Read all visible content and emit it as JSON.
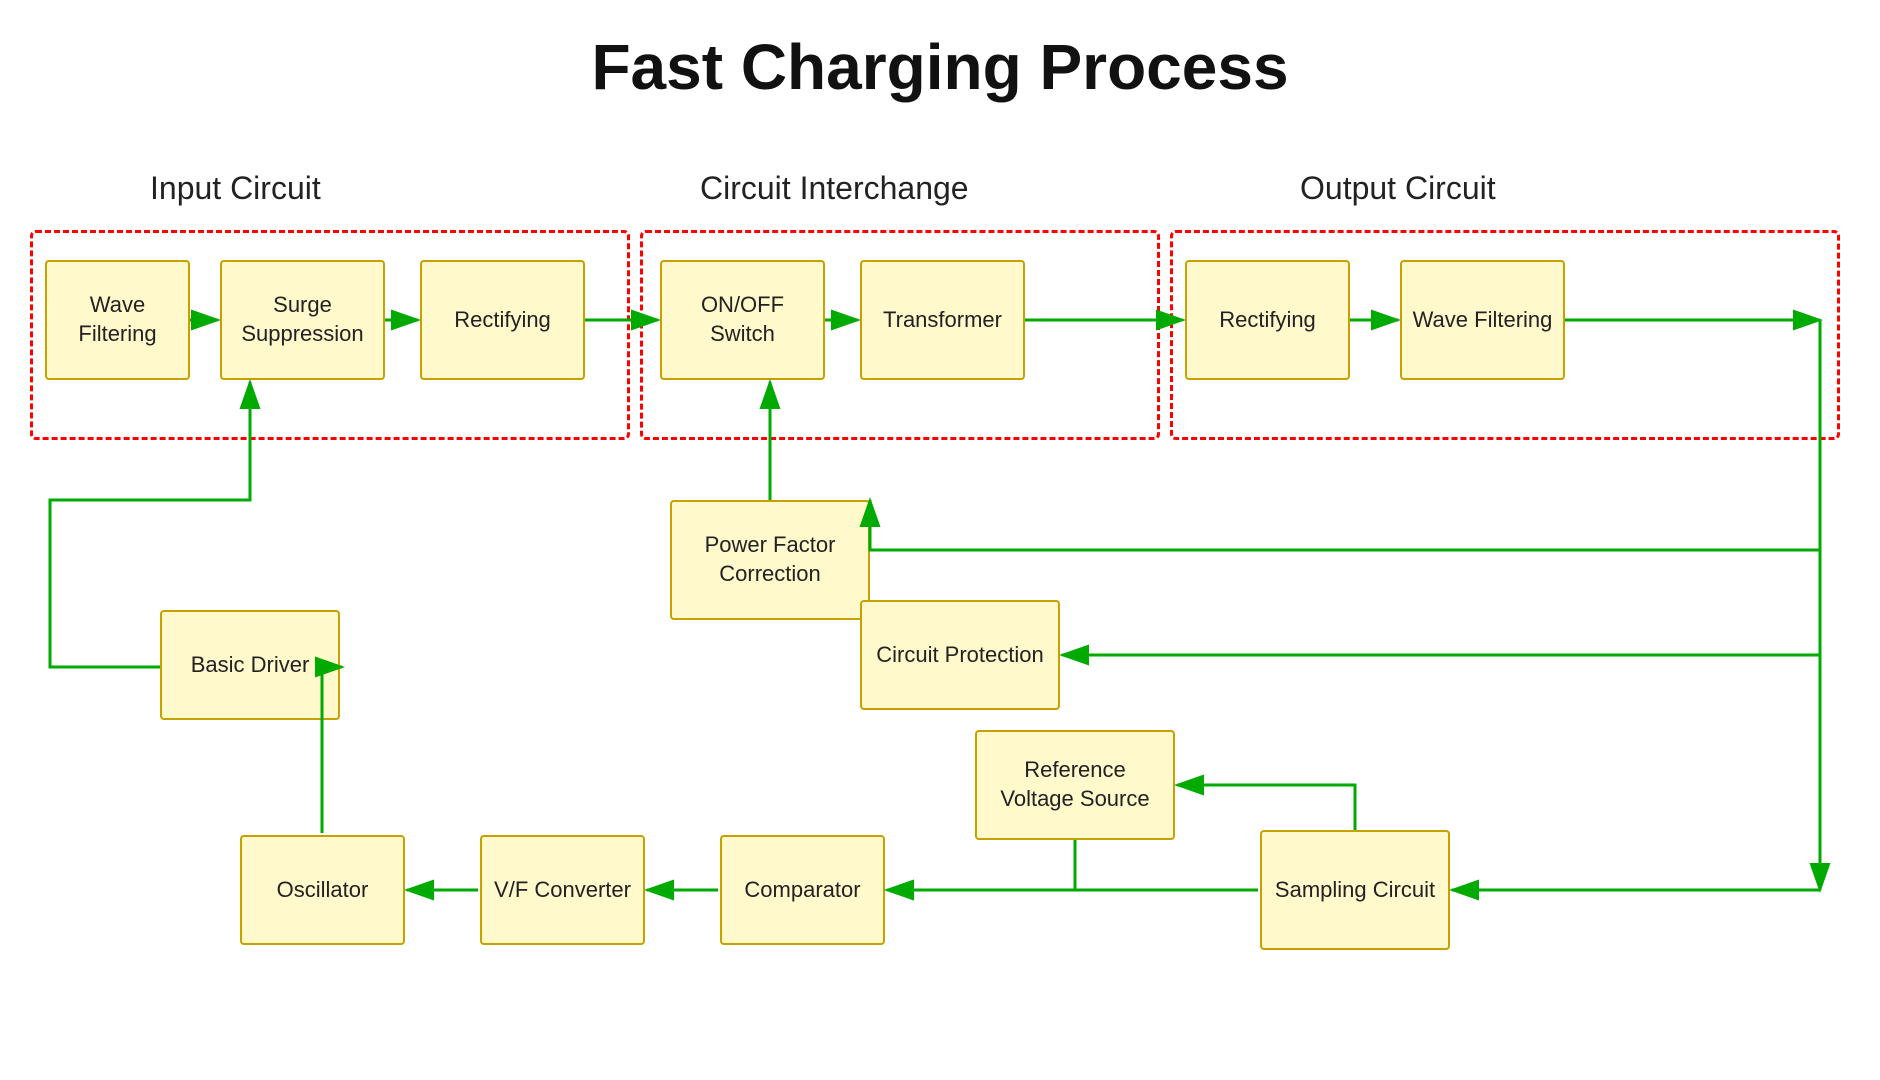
{
  "title": "Fast Charging Process",
  "sections": {
    "input": "Input Circuit",
    "interchange": "Circuit Interchange",
    "output": "Output Circuit"
  },
  "boxes": {
    "wave_filter_in": "Wave\nFiltering",
    "surge_suppression": "Surge\nSuppression",
    "rectify_in": "Rectifying",
    "onoff_switch": "ON/OFF\nSwitch",
    "transformer": "Transformer",
    "rectify_out": "Rectifying",
    "wave_filter_out": "Wave\nFiltering",
    "power_factor": "Power Factor\nCorrection",
    "circuit_protection": "Circuit\nProtection",
    "reference_voltage": "Reference\nVoltage Source",
    "sampling_circuit": "Sampling\nCircuit",
    "basic_driver": "Basic Driver",
    "oscillator": "Oscillator",
    "vf_converter": "V/F Converter",
    "comparator": "Comparator"
  }
}
